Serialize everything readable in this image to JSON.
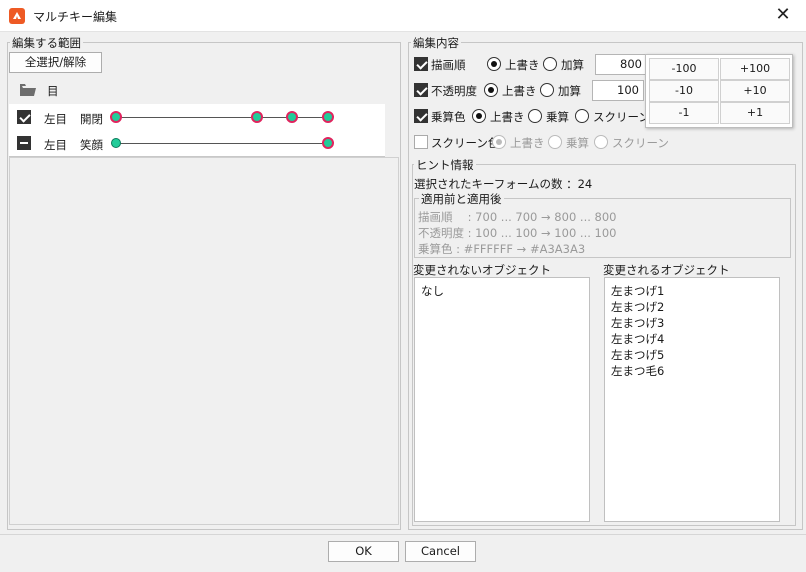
{
  "window": {
    "title": "マルチキー編集",
    "close_glyph": "✕"
  },
  "range": {
    "group_label": "編集する範囲",
    "select_all_label": "全選択/解除",
    "folder_label": "目",
    "rows": [
      {
        "check": "checked",
        "label_a": "左目",
        "label_b": "開閉"
      },
      {
        "check": "indeterminate",
        "label_a": "左目",
        "label_b": "笑顔"
      }
    ]
  },
  "content": {
    "group_label": "編集内容",
    "draw_order": {
      "label": "描画順",
      "overwrite": "上書き",
      "add": "加算",
      "value": "800",
      "selected": "overwrite"
    },
    "opacity": {
      "label": "不透明度",
      "overwrite": "上書き",
      "add": "加算",
      "value": "100",
      "selected": "overwrite"
    },
    "multiply": {
      "label": "乗算色",
      "overwrite": "上書き",
      "multiply": "乗算",
      "screen": "スクリーン",
      "selected": "overwrite"
    },
    "screen_color": {
      "label": "スクリーン色",
      "overwrite": "上書き",
      "multiply": "乗算",
      "screen": "スクリーン",
      "selected": "overwrite"
    }
  },
  "stepper": {
    "buttons": [
      "-100",
      "+100",
      "-10",
      "+10",
      "-1",
      "+1"
    ]
  },
  "hint": {
    "group_label": "ヒント情報",
    "selected_count": "選択されたキーフォームの数 ：24",
    "before_after_label": "適用前と適用後",
    "lines": [
      "描画順　 : 700 ... 700 → 800 ... 800",
      "不透明度 : 100 ... 100 → 100 ... 100",
      "乗算色 : #FFFFFF → #A3A3A3"
    ]
  },
  "unchanged": {
    "label": "変更されないオブジェクト",
    "items": [
      "なし"
    ]
  },
  "changed": {
    "label": "変更されるオブジェクト",
    "items": [
      "左まつげ1",
      "左まつげ2",
      "左まつげ3",
      "左まつげ4",
      "左まつげ5",
      "左まつ毛6"
    ]
  },
  "footer": {
    "ok": "OK",
    "cancel": "Cancel"
  },
  "colors": {
    "accent": "#ee5a24",
    "key_fill": "#22cc99",
    "key_selected": "#e0245e"
  }
}
